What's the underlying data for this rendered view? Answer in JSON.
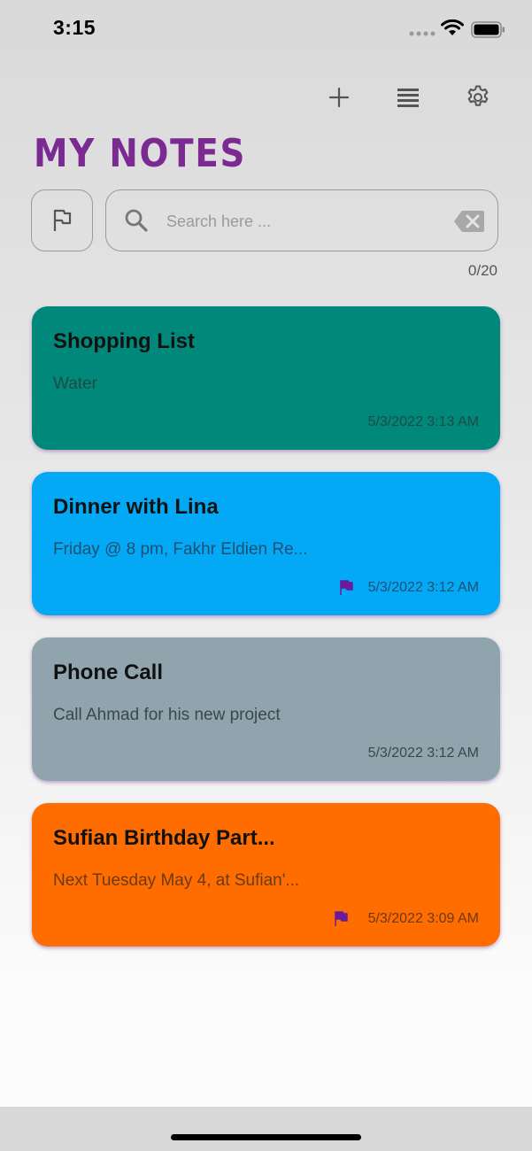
{
  "status_bar": {
    "time": "3:15"
  },
  "toolbar": {
    "add_icon": "plus-icon",
    "list_icon": "list-icon",
    "settings_icon": "gear-icon"
  },
  "page": {
    "title": "MY NOTES",
    "title_color": "#7b2a92"
  },
  "search": {
    "placeholder": "Search here ...",
    "value": "",
    "counter": "0/20"
  },
  "notes": [
    {
      "title": "Shopping List",
      "body": "Water",
      "date": "5/3/2022 3:13 AM",
      "flagged": false,
      "color": "#00897b"
    },
    {
      "title": "Dinner with Lina",
      "body": "Friday @ 8 pm, Fakhr Eldien Re...",
      "date": "5/3/2022 3:12 AM",
      "flagged": true,
      "color": "#03a9f4"
    },
    {
      "title": "Phone Call",
      "body": "Call Ahmad for his new project",
      "date": "5/3/2022 3:12 AM",
      "flagged": false,
      "color": "#90a4ae"
    },
    {
      "title": "Sufian Birthday Part...",
      "body": "Next Tuesday May 4, at Sufian'...",
      "date": "5/3/2022 3:09 AM",
      "flagged": true,
      "color": "#ff6d00"
    }
  ],
  "colors": {
    "flag": "#6a1b9a",
    "accent": "#7b2a92"
  }
}
